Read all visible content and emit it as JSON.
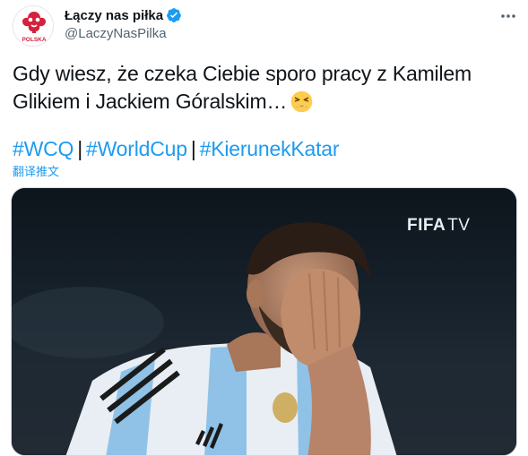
{
  "author": {
    "display_name": "Łączy nas piłka",
    "handle": "@LaczyNasPilka",
    "avatar_label": "POLSKA",
    "verified_icon": "verified-badge-icon",
    "verified_color": "#1d9bf0"
  },
  "more_icon": "more-horizontal-icon",
  "tweet": {
    "text_line1": "Gdy wiesz, że czeka Ciebie sporo pracy z Kamilem",
    "text_line2": "Glikiem i Jackiem Góralskim…",
    "emoji_icon": "tired-face-emoji-icon",
    "hashtags": [
      "#WCQ",
      "#WorldCup",
      "#KierunekKatar"
    ],
    "separator": "|",
    "translate_label": "翻译推文"
  },
  "media": {
    "type": "video-thumbnail",
    "badge_fifa": "FIFA",
    "badge_tv": "TV"
  },
  "colors": {
    "link": "#1d9bf0",
    "text": "#0f1419",
    "secondary": "#536471"
  }
}
